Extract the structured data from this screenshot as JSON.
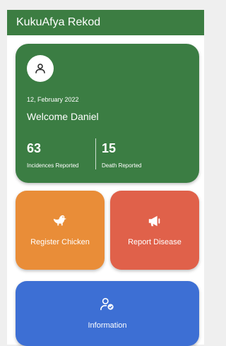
{
  "appbar": {
    "title": "KukuAfya Rekod"
  },
  "profile": {
    "date": "12, February 2022",
    "welcome": "Welcome Daniel",
    "stats": [
      {
        "value": "63",
        "label": "Incidences Reported"
      },
      {
        "value": "15",
        "label": "Death Reported"
      }
    ]
  },
  "tiles": {
    "register": {
      "label": "Register Chicken",
      "icon": "chicken-icon",
      "color": "#e98d38"
    },
    "report": {
      "label": "Report Disease",
      "icon": "megaphone-icon",
      "color": "#e0614a"
    },
    "information": {
      "label": "Information",
      "icon": "user-check-icon",
      "color": "#3d6fd4"
    }
  },
  "colors": {
    "appbar": "#3c7d42",
    "profile_card": "#3b7d43"
  }
}
